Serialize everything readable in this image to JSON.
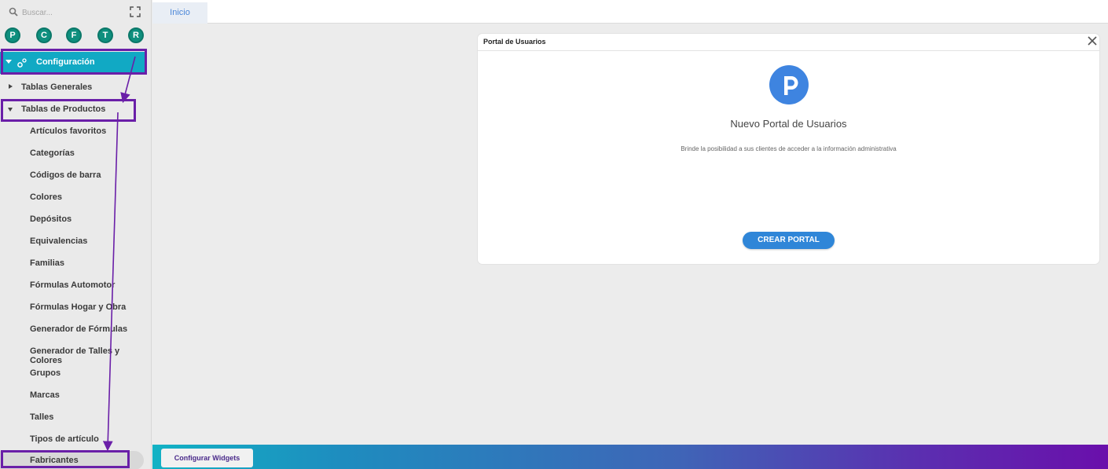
{
  "search": {
    "placeholder": "Buscar..."
  },
  "quick_buttons": [
    "P",
    "C",
    "F",
    "T",
    "R"
  ],
  "menu": {
    "configuracion": "Configuración",
    "tablas_generales": "Tablas Generales",
    "tablas_productos": "Tablas de Productos",
    "children": [
      "Artículos favoritos",
      "Categorías",
      "Códigos de barra",
      "Colores",
      "Depósitos",
      "Equivalencias",
      "Familias",
      "Fórmulas Automotor",
      "Fórmulas Hogar y Obra",
      "Generador de Fórmulas",
      "Generador de Talles y Colores",
      "Grupos",
      "Marcas",
      "Talles",
      "Tipos de artículo",
      "Fabricantes"
    ]
  },
  "tabs": [
    "Inicio"
  ],
  "panel": {
    "title": "Portal de Usuarios",
    "heading": "Nuevo Portal de Usuarios",
    "description": "Brinde la posibilidad a sus clientes de acceder a la información administrativa",
    "button": "CREAR PORTAL"
  },
  "footer": {
    "button": "Configurar Widgets"
  },
  "colors": {
    "accent": "#11a9c4",
    "quick_button": "#0e8f7e",
    "highlight": "#6a1fa8",
    "primary_button": "#2f86d8"
  }
}
